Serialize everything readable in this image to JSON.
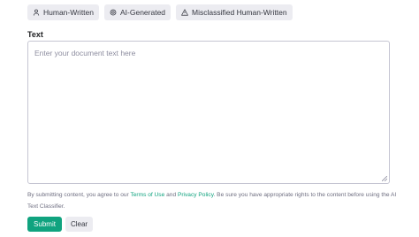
{
  "tabs": [
    {
      "label": "Human-Written",
      "icon": "person-icon"
    },
    {
      "label": "AI-Generated",
      "icon": "openai-logo-icon"
    },
    {
      "label": "Misclassified Human-Written",
      "icon": "warning-triangle-icon"
    }
  ],
  "form": {
    "text_label": "Text",
    "textarea_placeholder": "Enter your document text here",
    "textarea_value": ""
  },
  "disclaimer": {
    "prefix": "By submitting content, you agree to our ",
    "terms_link": "Terms of Use",
    "and": " and ",
    "privacy_link": "Privacy Policy",
    "suffix": ". Be sure you have appropriate rights to the content before using the AI Text Classifier."
  },
  "buttons": {
    "submit": "Submit",
    "clear": "Clear"
  },
  "colors": {
    "accent": "#10a37f",
    "tab_bg": "#ececf1",
    "border": "#c5c5d2",
    "muted_text": "#6e6e80"
  }
}
